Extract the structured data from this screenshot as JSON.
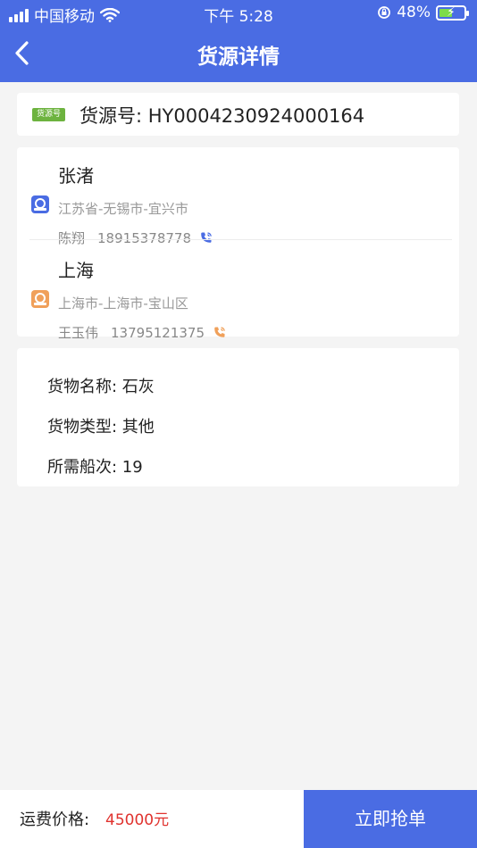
{
  "status_bar": {
    "carrier": "中国移动",
    "time": "下午 5:28",
    "battery": "48%"
  },
  "nav": {
    "title": "货源详情"
  },
  "source": {
    "tag": "货源号",
    "label": "货源号: HY0004230924000164"
  },
  "origin": {
    "city": "张渚",
    "region": "江苏省-无锡市-宜兴市",
    "contact_name": "陈翔",
    "contact_phone": "18915378778"
  },
  "destination": {
    "city": "上海",
    "region": "上海市-上海市-宝山区",
    "contact_name": "王玉伟",
    "contact_phone": "13795121375"
  },
  "goods": {
    "name": "货物名称:  石灰",
    "type": "货物类型:  其他",
    "trips": "所需船次:  19"
  },
  "footer": {
    "price_label": "运费价格:",
    "price_value": "45000元",
    "grab_button": "立即抢单"
  },
  "colors": {
    "primary": "#4a6ce3",
    "price": "#e0322e",
    "tag": "#6db33f",
    "origin_icon": "#4a6ce3",
    "destination_icon": "#f0a05a"
  },
  "icons": {
    "back": "chevron-left-icon",
    "wifi": "wifi-icon",
    "origin": "origin-location-icon",
    "destination": "destination-location-icon",
    "phone": "phone-icon"
  }
}
